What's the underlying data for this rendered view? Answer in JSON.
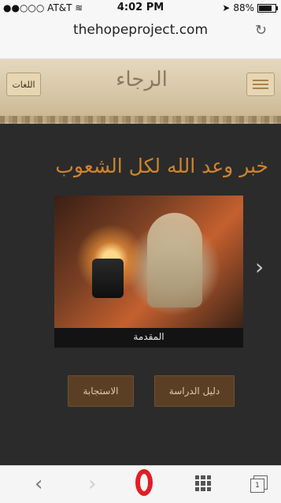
{
  "status_bar": {
    "carrier": "●●○○○ AT&T",
    "wifi_icon": "wifi-icon",
    "time": "4:02 PM",
    "location_icon": "location-arrow-icon",
    "battery_percent": "88%",
    "battery_level": 0.88
  },
  "browser": {
    "url": "thehopeproject.com",
    "reload_icon": "↻"
  },
  "site_header": {
    "languages_button": "اللغات",
    "logo_text": "الرجاء",
    "menu_icon": "hamburger-menu-icon"
  },
  "main": {
    "title": "خبر وعد الله لكل الشعوب",
    "video_caption": "المقدمة",
    "next_arrow": "›",
    "buttons": {
      "response": "الاستجابة",
      "study_guide": "دليل الدراسة"
    }
  },
  "toolbar": {
    "back": "‹",
    "forward": "›",
    "speed_dial_icon": "grid-icon",
    "tabs_count": "1"
  },
  "colors": {
    "title_orange": "#d0842e",
    "button_brown": "#5a3f25",
    "opera_red": "#e11e26"
  }
}
